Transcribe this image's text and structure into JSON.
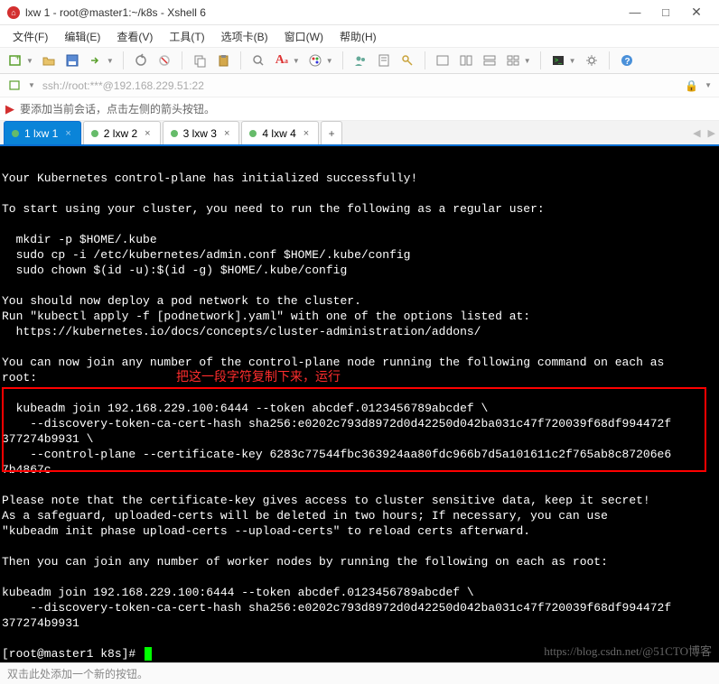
{
  "window": {
    "title": "lxw 1 - root@master1:~/k8s - Xshell 6",
    "min": "—",
    "max": "□",
    "close": "✕"
  },
  "menu": {
    "file": "文件(F)",
    "edit": "编辑(E)",
    "view": "查看(V)",
    "tools": "工具(T)",
    "tabs": "选项卡(B)",
    "window": "窗口(W)",
    "help": "帮助(H)"
  },
  "addressbar": {
    "text": "ssh://root:***@192.168.229.51:22"
  },
  "tipbar": {
    "text": "要添加当前会话，点击左侧的箭头按钮。"
  },
  "tabs": [
    {
      "label": "1 lxw 1",
      "active": true
    },
    {
      "label": "2 lxw 2",
      "active": false
    },
    {
      "label": "3 lxw 3",
      "active": false
    },
    {
      "label": "4 lxw 4",
      "active": false
    }
  ],
  "tab_add": "+",
  "terminal": {
    "annotation": "把这一段字符复制下来，运行",
    "lines": [
      "",
      "Your Kubernetes control-plane has initialized successfully!",
      "",
      "To start using your cluster, you need to run the following as a regular user:",
      "",
      "  mkdir -p $HOME/.kube",
      "  sudo cp -i /etc/kubernetes/admin.conf $HOME/.kube/config",
      "  sudo chown $(id -u):$(id -g) $HOME/.kube/config",
      "",
      "You should now deploy a pod network to the cluster.",
      "Run \"kubectl apply -f [podnetwork].yaml\" with one of the options listed at:",
      "  https://kubernetes.io/docs/concepts/cluster-administration/addons/",
      "",
      "You can now join any number of the control-plane node running the following command on each as",
      "root:",
      "",
      "  kubeadm join 192.168.229.100:6444 --token abcdef.0123456789abcdef \\",
      "    --discovery-token-ca-cert-hash sha256:e0202c793d8972d0d42250d042ba031c47f720039f68df994472f",
      "377274b9931 \\",
      "    --control-plane --certificate-key 6283c77544fbc363924aa80fdc966b7d5a101611c2f765ab8c87206e6",
      "7b4867c",
      "",
      "Please note that the certificate-key gives access to cluster sensitive data, keep it secret!",
      "As a safeguard, uploaded-certs will be deleted in two hours; If necessary, you can use",
      "\"kubeadm init phase upload-certs --upload-certs\" to reload certs afterward.",
      "",
      "Then you can join any number of worker nodes by running the following on each as root:",
      "",
      "kubeadm join 192.168.229.100:6444 --token abcdef.0123456789abcdef \\",
      "    --discovery-token-ca-cert-hash sha256:e0202c793d8972d0d42250d042ba031c47f720039f68df994472f",
      "377274b9931"
    ],
    "prompt": "[root@master1 k8s]# ",
    "watermark": "https://blog.csdn.net/@51CTO博客"
  },
  "statusbar": {
    "text": "双击此处添加一个新的按钮。"
  }
}
